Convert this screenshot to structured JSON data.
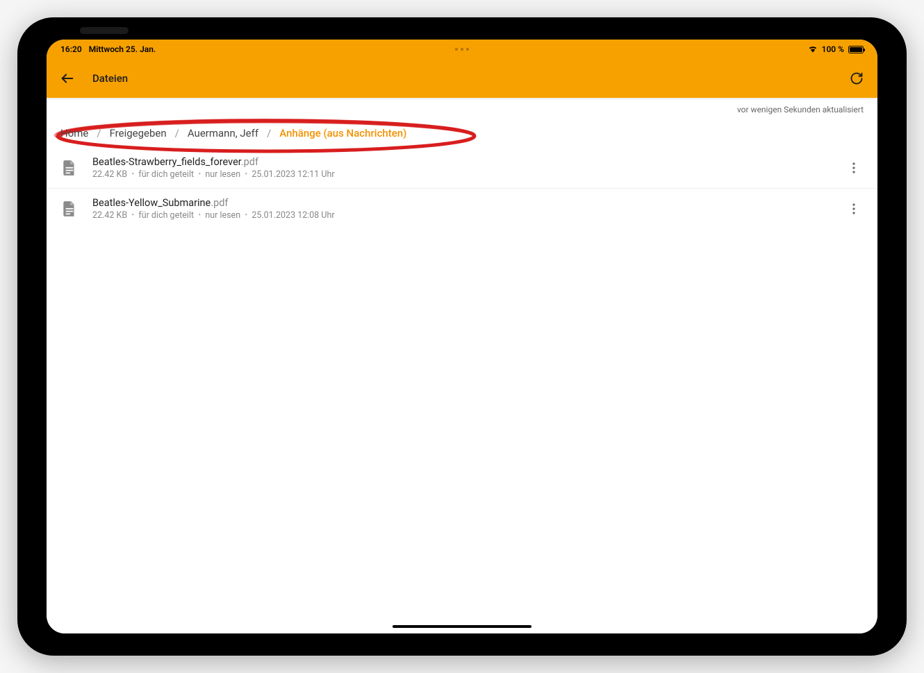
{
  "status": {
    "time": "16:20",
    "date": "Mittwoch 25. Jan.",
    "battery": "100 %"
  },
  "appbar": {
    "title": "Dateien"
  },
  "updated": "vor wenigen Sekunden aktualisiert",
  "breadcrumb": [
    {
      "label": "Home",
      "active": false
    },
    {
      "label": "Freigegeben",
      "active": false
    },
    {
      "label": "Auermann, Jeff",
      "active": false
    },
    {
      "label": "Anhänge (aus Nachrichten)",
      "active": true
    }
  ],
  "files": [
    {
      "name": "Beatles-Strawberry_fields_forever",
      "ext": ".pdf",
      "size": "22.42 KB",
      "shared": "für dich geteilt",
      "perm": "nur lesen",
      "date": "25.01.2023 12:11 Uhr"
    },
    {
      "name": "Beatles-Yellow_Submarine",
      "ext": ".pdf",
      "size": "22.42 KB",
      "shared": "für dich geteilt",
      "perm": "nur lesen",
      "date": "25.01.2023 12:08 Uhr"
    }
  ]
}
